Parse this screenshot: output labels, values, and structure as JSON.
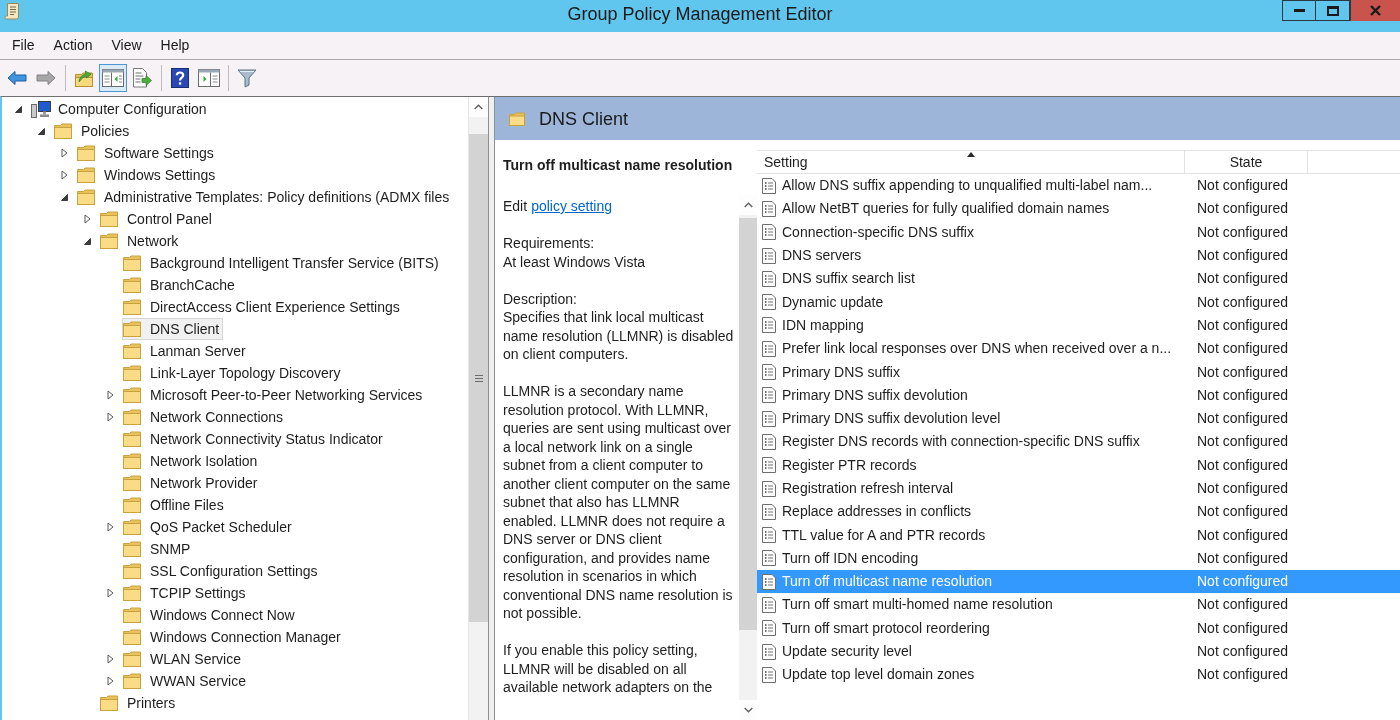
{
  "window": {
    "title": "Group Policy Management Editor"
  },
  "menu": [
    "File",
    "Action",
    "View",
    "Help"
  ],
  "toolbar": [
    [
      {
        "kind": "back",
        "disabled": false,
        "pressed": false
      },
      {
        "kind": "forward",
        "disabled": true,
        "pressed": false
      }
    ],
    [
      {
        "kind": "up-folder",
        "disabled": false,
        "pressed": false
      },
      {
        "kind": "console-tree",
        "disabled": false,
        "pressed": true
      },
      {
        "kind": "export-list",
        "disabled": false,
        "pressed": false
      }
    ],
    [
      {
        "kind": "help",
        "disabled": false,
        "pressed": false
      },
      {
        "kind": "action-pane",
        "disabled": false,
        "pressed": false
      }
    ],
    [
      {
        "kind": "filter",
        "disabled": false,
        "pressed": false
      }
    ]
  ],
  "tree": [
    {
      "label": "Computer Configuration",
      "kind": "computer",
      "expanded": true,
      "selected": false,
      "children": [
        {
          "label": "Policies",
          "kind": "folder",
          "expanded": true,
          "selected": false,
          "children": [
            {
              "label": "Software Settings",
              "kind": "folder",
              "expanded": false,
              "selected": false
            },
            {
              "label": "Windows Settings",
              "kind": "folder",
              "expanded": false,
              "selected": false
            },
            {
              "label": "Administrative Templates: Policy definitions (ADMX files",
              "kind": "folder",
              "expanded": true,
              "selected": false,
              "children": [
                {
                  "label": "Control Panel",
                  "kind": "folder",
                  "expanded": false,
                  "selected": false
                },
                {
                  "label": "Network",
                  "kind": "folder",
                  "expanded": true,
                  "selected": false,
                  "children": [
                    {
                      "label": "Background Intelligent Transfer Service (BITS)",
                      "kind": "folder",
                      "selected": false
                    },
                    {
                      "label": "BranchCache",
                      "kind": "folder",
                      "selected": false
                    },
                    {
                      "label": "DirectAccess Client Experience Settings",
                      "kind": "folder",
                      "selected": false
                    },
                    {
                      "label": "DNS Client",
                      "kind": "folder",
                      "selected": true
                    },
                    {
                      "label": "Lanman Server",
                      "kind": "folder",
                      "selected": false
                    },
                    {
                      "label": "Link-Layer Topology Discovery",
                      "kind": "folder",
                      "selected": false
                    },
                    {
                      "label": "Microsoft Peer-to-Peer Networking Services",
                      "kind": "folder",
                      "expanded": false,
                      "selected": false
                    },
                    {
                      "label": "Network Connections",
                      "kind": "folder",
                      "expanded": false,
                      "selected": false
                    },
                    {
                      "label": "Network Connectivity Status Indicator",
                      "kind": "folder",
                      "selected": false
                    },
                    {
                      "label": "Network Isolation",
                      "kind": "folder",
                      "selected": false
                    },
                    {
                      "label": "Network Provider",
                      "kind": "folder",
                      "selected": false
                    },
                    {
                      "label": "Offline Files",
                      "kind": "folder",
                      "selected": false
                    },
                    {
                      "label": "QoS Packet Scheduler",
                      "kind": "folder",
                      "expanded": false,
                      "selected": false
                    },
                    {
                      "label": "SNMP",
                      "kind": "folder",
                      "selected": false
                    },
                    {
                      "label": "SSL Configuration Settings",
                      "kind": "folder",
                      "selected": false
                    },
                    {
                      "label": "TCPIP Settings",
                      "kind": "folder",
                      "expanded": false,
                      "selected": false
                    },
                    {
                      "label": "Windows Connect Now",
                      "kind": "folder",
                      "selected": false
                    },
                    {
                      "label": "Windows Connection Manager",
                      "kind": "folder",
                      "selected": false
                    },
                    {
                      "label": "WLAN Service",
                      "kind": "folder",
                      "expanded": false,
                      "selected": false
                    },
                    {
                      "label": "WWAN Service",
                      "kind": "folder",
                      "expanded": false,
                      "selected": false
                    }
                  ]
                },
                {
                  "label": "Printers",
                  "kind": "folder",
                  "selected": false
                }
              ]
            }
          ]
        }
      ]
    }
  ],
  "header": {
    "title": "DNS Client"
  },
  "details": {
    "title": "Turn off multicast name resolution",
    "edit_label": "Edit",
    "edit_link": "policy setting",
    "requirements_label": "Requirements:",
    "requirements": "At least Windows Vista",
    "description_label": "Description:",
    "paragraphs": [
      "Specifies that link local multicast name resolution (LLMNR) is disabled on client computers.",
      "LLMNR is a secondary name resolution protocol. With LLMNR, queries are sent using multicast over a local network link on a single subnet from a client computer to another client computer on the same subnet that also has LLMNR enabled. LLMNR does not require a DNS server or DNS client configuration, and provides name resolution in scenarios in which conventional DNS name resolution is not possible.",
      "If you enable this policy setting, LLMNR will be disabled on all available network adapters on the"
    ]
  },
  "list": {
    "columns": [
      {
        "label": "Setting",
        "sorted": true
      },
      {
        "label": "State",
        "sorted": false
      }
    ],
    "rows": [
      {
        "setting": "Allow DNS suffix appending to unqualified multi-label nam...",
        "state": "Not configured",
        "selected": false
      },
      {
        "setting": "Allow NetBT queries for fully qualified domain names",
        "state": "Not configured",
        "selected": false
      },
      {
        "setting": "Connection-specific DNS suffix",
        "state": "Not configured",
        "selected": false
      },
      {
        "setting": "DNS servers",
        "state": "Not configured",
        "selected": false
      },
      {
        "setting": "DNS suffix search list",
        "state": "Not configured",
        "selected": false
      },
      {
        "setting": "Dynamic update",
        "state": "Not configured",
        "selected": false
      },
      {
        "setting": "IDN mapping",
        "state": "Not configured",
        "selected": false
      },
      {
        "setting": "Prefer link local responses over DNS when received over a n...",
        "state": "Not configured",
        "selected": false
      },
      {
        "setting": "Primary DNS suffix",
        "state": "Not configured",
        "selected": false
      },
      {
        "setting": "Primary DNS suffix devolution",
        "state": "Not configured",
        "selected": false
      },
      {
        "setting": "Primary DNS suffix devolution level",
        "state": "Not configured",
        "selected": false
      },
      {
        "setting": "Register DNS records with connection-specific DNS suffix",
        "state": "Not configured",
        "selected": false
      },
      {
        "setting": "Register PTR records",
        "state": "Not configured",
        "selected": false
      },
      {
        "setting": "Registration refresh interval",
        "state": "Not configured",
        "selected": false
      },
      {
        "setting": "Replace addresses in conflicts",
        "state": "Not configured",
        "selected": false
      },
      {
        "setting": "TTL value for A and PTR records",
        "state": "Not configured",
        "selected": false
      },
      {
        "setting": "Turn off IDN encoding",
        "state": "Not configured",
        "selected": false
      },
      {
        "setting": "Turn off multicast name resolution",
        "state": "Not configured",
        "selected": true
      },
      {
        "setting": "Turn off smart multi-homed name resolution",
        "state": "Not configured",
        "selected": false
      },
      {
        "setting": "Turn off smart protocol reordering",
        "state": "Not configured",
        "selected": false
      },
      {
        "setting": "Update security level",
        "state": "Not configured",
        "selected": false
      },
      {
        "setting": "Update top level domain zones",
        "state": "Not configured",
        "selected": false
      }
    ]
  }
}
